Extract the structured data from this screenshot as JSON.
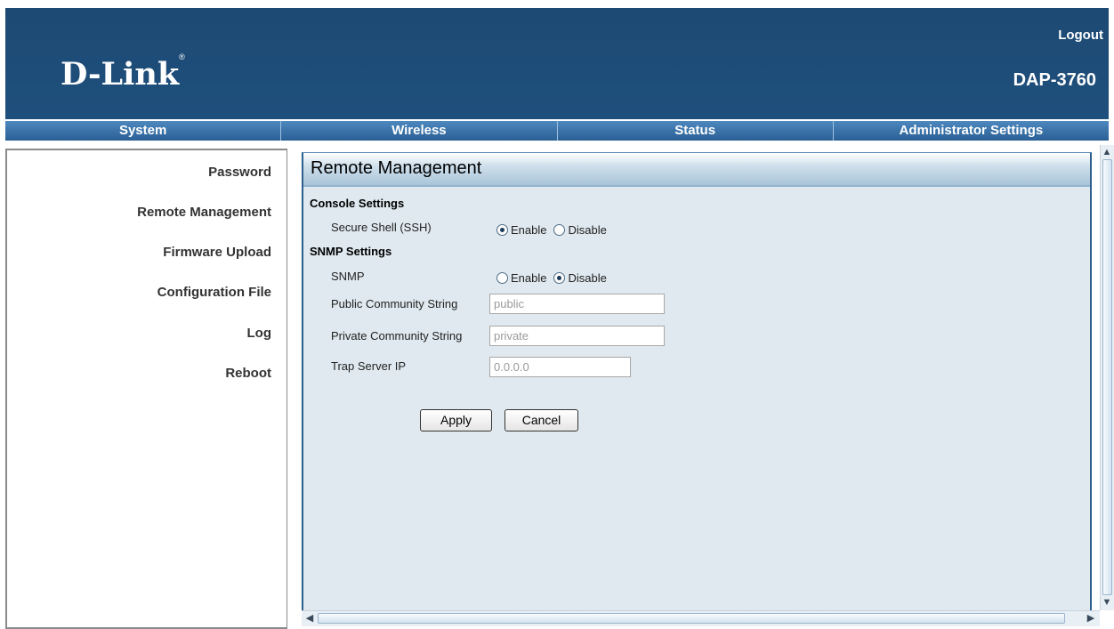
{
  "header": {
    "logo": "D-Link",
    "logo_mark": "®",
    "logout": "Logout",
    "model": "DAP-3760"
  },
  "menu": [
    "System",
    "Wireless",
    "Status",
    "Administrator Settings"
  ],
  "sidebar": {
    "items": [
      "Password",
      "Remote Management",
      "Firmware Upload",
      "Configuration File",
      "Log",
      "Reboot"
    ]
  },
  "content": {
    "title": "Remote Management",
    "console_section": "Console Settings",
    "ssh_label": "Secure Shell (SSH)",
    "ssh_value": "Enable",
    "snmp_section": "SNMP Settings",
    "snmp_label": "SNMP",
    "snmp_value": "Disable",
    "enable_label": "Enable",
    "disable_label": "Disable",
    "public_label": "Public Community String",
    "public_value": "public",
    "private_label": "Private Community String",
    "private_value": "private",
    "trap_label": "Trap Server IP",
    "trap_value": "0.0.0.0",
    "apply": "Apply",
    "cancel": "Cancel"
  },
  "icons": {
    "scroll_up": "triangle-up",
    "scroll_down": "triangle-down",
    "scroll_left": "triangle-left",
    "scroll_right": "triangle-right"
  },
  "colors": {
    "header_bg": "#1f4e79",
    "menu_bg": "#3a70a6",
    "panel_bg": "#dfe9ef"
  }
}
